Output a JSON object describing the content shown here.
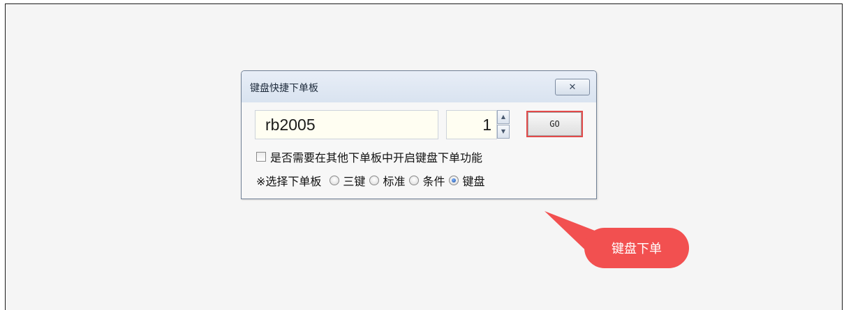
{
  "dialog": {
    "title": "键盘快捷下单板",
    "close_icon": "close-icon",
    "symbol_value": "rb2005",
    "quantity_value": "1",
    "go_label": "GO",
    "enable_keyboard_label": "是否需要在其他下单板中开启键盘下单功能",
    "enable_keyboard_checked": false,
    "panel_select_title": "※选择下单板",
    "panel_options": [
      {
        "label": "三键",
        "checked": false
      },
      {
        "label": "标准",
        "checked": false
      },
      {
        "label": "条件",
        "checked": false
      },
      {
        "label": "键盘",
        "checked": true
      }
    ]
  },
  "callout": {
    "text": "键盘下单",
    "color": "#f25050"
  },
  "colors": {
    "highlight_border": "#e24a4a",
    "titlebar": "#dde6f2"
  }
}
